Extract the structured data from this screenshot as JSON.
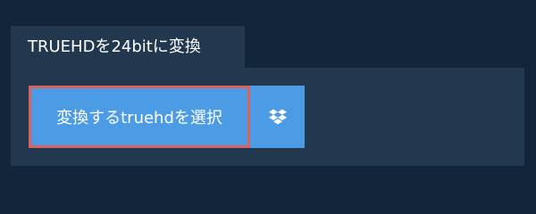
{
  "header": {
    "title": "TRUEHDを24bitに変換"
  },
  "converter": {
    "select_button_label": "変換するtruehdを選択",
    "dropbox_icon": "dropbox-icon"
  },
  "colors": {
    "background": "#13253b",
    "panel": "#22384f",
    "button": "#4c9ce5",
    "focus_border": "#d9625e"
  }
}
